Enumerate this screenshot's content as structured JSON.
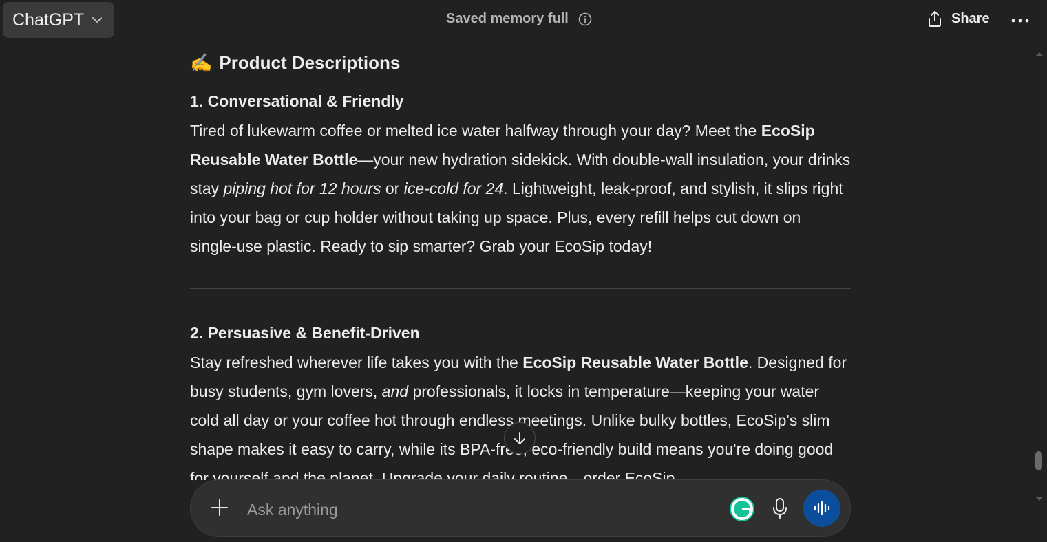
{
  "header": {
    "model_label": "ChatGPT",
    "memory_status": "Saved memory full",
    "share_label": "Share"
  },
  "content": {
    "heading_emoji": "✍️",
    "heading": "Product Descriptions",
    "sections": [
      {
        "title": "1. Conversational & Friendly",
        "text": "Tired of lukewarm coffee or melted ice water halfway through your day? Meet the EcoSip Reusable Water Bottle—your new hydration sidekick. With double-wall insulation, your drinks stay piping hot for 12 hours or ice-cold for 24. Lightweight, leak-proof, and stylish, it slips right into your bag or cup holder without taking up space. Plus, every refill helps cut down on single-use plastic. Ready to sip smarter? Grab your EcoSip today!"
      },
      {
        "title": "2. Persuasive & Benefit-Driven",
        "text": "Stay refreshed wherever life takes you with the EcoSip Reusable Water Bottle. Designed for busy students, gym lovers, and professionals, it locks in temperature—keeping your water cold all day or your coffee hot through endless meetings. Unlike bulky bottles, EcoSip's slim shape makes it easy to carry, while its BPA-free, eco-friendly build means you're doing good for yourself and the planet. Upgrade your daily routine—order EcoSip"
      }
    ]
  },
  "composer": {
    "placeholder": "Ask anything"
  },
  "colors": {
    "background": "#212121",
    "composer_bg": "#303030",
    "voice_button": "#0b4f9c",
    "grammarly": "#15c39a"
  },
  "icons": {
    "model_chevron": "chevron-down-icon",
    "memory_info": "info-icon",
    "share": "share-icon",
    "more": "more-horizontal-icon",
    "scroll_down": "arrow-down-icon",
    "plus": "plus-icon",
    "grammarly": "grammarly-icon",
    "mic": "microphone-icon",
    "voice": "voice-mode-icon"
  }
}
